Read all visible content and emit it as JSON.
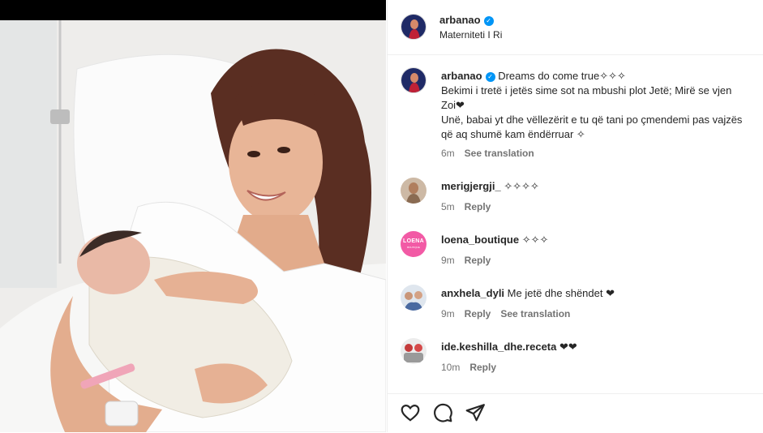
{
  "post": {
    "author": "arbanao",
    "location": "Materniteti I Ri"
  },
  "caption": {
    "username": "arbanao",
    "line1": "Dreams do come true✧✧✧",
    "line2": "Bekimi i tretë i jetës sime sot na mbushi plot Jetë; Mirë se vjen",
    "line3": "Zoi❤",
    "line4": "Unë, babai yt dhe vëllezërit e tu që tani po çmendemi pas vajzës",
    "line5": "që aq shumë kam ëndërruar ✧",
    "time": "6m",
    "translate": "See translation"
  },
  "comments": [
    {
      "username": "merigjergji_",
      "text": "✧✧✧✧",
      "time": "5m",
      "reply": "Reply",
      "translate": ""
    },
    {
      "username": "loena_boutique",
      "text": "✧✧✧",
      "time": "9m",
      "reply": "Reply",
      "translate": "",
      "avatar_text": "LOENA",
      "avatar_sub": "BOUTIQUE"
    },
    {
      "username": "anxhela_dyli",
      "text": "Me jetë dhe shëndet ❤",
      "time": "9m",
      "reply": "Reply",
      "translate": "See translation"
    },
    {
      "username": "ide.keshilla_dhe.receta",
      "text": "❤❤",
      "time": "10m",
      "reply": "Reply",
      "translate": ""
    }
  ],
  "icons": {
    "like": "heart-icon",
    "comment": "comment-icon",
    "share": "share-icon",
    "verified": "verified-badge-icon"
  },
  "colors": {
    "accent": "#0095f6",
    "loena_pink": "#f25aa5"
  }
}
